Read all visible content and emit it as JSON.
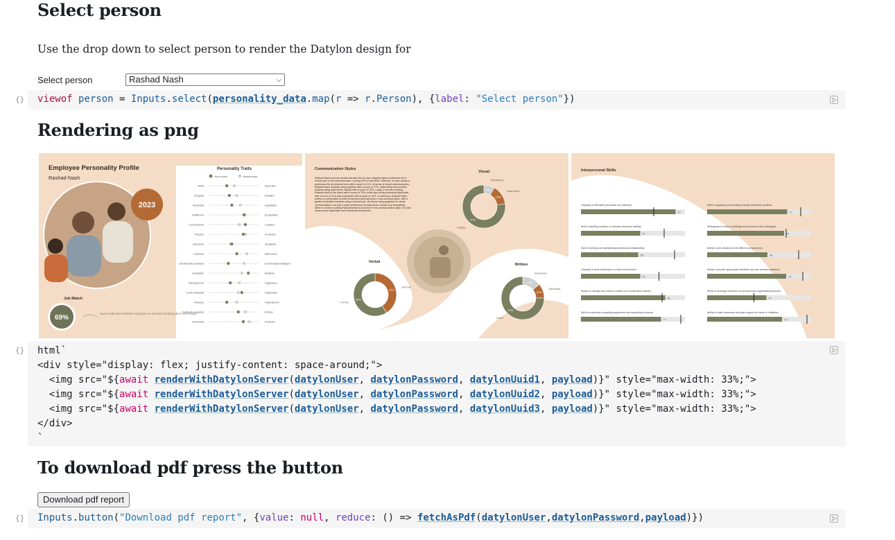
{
  "sections": {
    "select_title": "Select person",
    "select_desc": "Use the drop down to select person to render the Datylon design for",
    "png_title": "Rendering as png",
    "pdf_title": "To download pdf press the button"
  },
  "select": {
    "label": "Select person",
    "value": "Rashad Nash"
  },
  "cells": {
    "gutter_icon": "{}",
    "cell1": {
      "viewof": "viewof",
      "person": "person",
      "eq": " = ",
      "inputs": "Inputs",
      "dot1": ".",
      "select": "select",
      "open": "(",
      "pdata": "personality_data",
      "dot2": ".",
      "map": "map",
      "open2": "(",
      "r": "r",
      "arrow": " => ",
      "r2": "r",
      "dot3": ".",
      "Person": "Person",
      "close": "), {",
      "labelkey": "label",
      "colon": ": ",
      "labelval": "\"Select person\"",
      "end": "})"
    },
    "cell2": {
      "l1": "html`",
      "l2": "<div style=\"display: flex; justify-content: space-around;\">",
      "img_pre": "  <img src=\"${",
      "await": "await",
      "render": "renderWithDatylonServer",
      "user": "datylonUser",
      "pass": "datylonPassword",
      "uuid1": "datylonUuid1",
      "uuid2": "datylonUuid2",
      "uuid3": "datylonUuid3",
      "payload": "payload",
      "img_post": ")}\" style=\"max-width: 33%;\">",
      "l6": "</div>",
      "l7": "`"
    },
    "cell3": {
      "inputs": "Inputs",
      "button": "button",
      "str": "\"Download pdf report\"",
      "mid": ", {",
      "value": "value",
      "null": "null",
      "reduce": "reduce",
      "fn": "() => ",
      "fetch": "fetchAsPdf",
      "user": "datylonUser",
      "pass": "datylonPassword",
      "payload": "payload",
      "end": ")})"
    }
  },
  "button": {
    "label": "Download pdf report"
  },
  "panel1": {
    "title": "Employee Personality Profile",
    "name": "Rashad Nash",
    "year": "2023",
    "traits_title": "Personality Traits",
    "legend_you": "Your score",
    "legend_bench": "Benchmark",
    "job_match_label": "Job Match",
    "job_match_value": "69%",
    "job_note": "Score indicates whether employee is overall matching their current job",
    "traits": [
      {
        "left": "Timid",
        "right": "Assertive",
        "v": 0.35,
        "b": 0.5
      },
      {
        "left": "Irregular",
        "right": "Realism",
        "v": 0.4,
        "b": 0.55
      },
      {
        "left": "Resistant",
        "right": "Adaptable",
        "v": 0.45,
        "b": 0.62
      },
      {
        "left": "Indifferent",
        "right": "Empathetic",
        "v": 0.7,
        "b": 0.68
      },
      {
        "left": "Conventional",
        "right": "Creative",
        "v": 0.72,
        "b": 0.6
      },
      {
        "left": "Passive",
        "right": "Proactive",
        "v": 0.68,
        "b": 0.72
      },
      {
        "left": "Impulsive",
        "right": "Analytical",
        "v": 0.45,
        "b": 0.42
      },
      {
        "left": "Careless",
        "right": "Meticulous",
        "v": 0.55,
        "b": 0.75
      },
      {
        "left": "Emotionally unaware",
        "right": "Emotionally intelligent",
        "v": 0.38,
        "b": 0.7
      },
      {
        "left": "Unreliable",
        "right": "Reliable",
        "v": 0.78,
        "b": 0.65
      },
      {
        "left": "Disorganized",
        "right": "Organized",
        "v": 0.42,
        "b": 0.6
      },
      {
        "left": "Confrontational",
        "right": "Diplomatic",
        "v": 0.65,
        "b": 0.58
      },
      {
        "left": "Follower",
        "right": "Inspirational",
        "v": 0.35,
        "b": 0.55
      },
      {
        "left": "Culturally unaware",
        "right": "Ethical",
        "v": 0.58,
        "b": 0.72
      },
      {
        "left": "Dishonest",
        "right": "Inclusive",
        "v": 0.68,
        "b": 0.8
      }
    ]
  },
  "panel2": {
    "title": "Communication Styles",
    "text": "Rashad Nash's survey results indicate that he has a slightly higher preference for a formal tone in his communication, scoring 59% in that area. However, he also shows a preference for an informal tone with a score of 41%. In terms of visual communication, Rashad leans towards using graphics with a score of 77%, while being less inclined towards using data-driven visuals with a score of 15%. Lastly, in terms of writing, Rashad tends to be direct with a score of 75%, while also being somewhat diplomatic with a score of 11% and expressive with a score of 14%. In summary, Rashad Nash prefers a combination of both formal and informal tones in his communication, with a greater inclination towards using a formal tone. He favors using graphics for visual communication, but has a lower preference for data-driven visuals and storytelling. When it comes to writing Rashad tends to be direct in his communication style, but also shows some diplomatic and expressive tendencies.",
    "visual": {
      "title": "Visual",
      "labels": [
        "Storytelling",
        "Data-driven",
        "Graphic"
      ],
      "values": [
        8,
        15,
        77
      ]
    },
    "verbal": {
      "title": "Verbal",
      "labels": [
        "Informal",
        "Formal"
      ],
      "values": [
        41,
        59
      ]
    },
    "written": {
      "title": "Written",
      "labels": [
        "Expressive",
        "Diplomatic",
        "Direct"
      ],
      "values": [
        14,
        11,
        75
      ]
    }
  },
  "panel3": {
    "title": "Interpersonal Skills",
    "skills_left": [
      {
        "label": "Capacity to effectively persuade and influence",
        "v": 91,
        "b": 70
      },
      {
        "label": "Skill in handling sensitive or delicate situations tactfully",
        "v": 57,
        "b": 80
      },
      {
        "label": "Skill in building and maintaining professional relationships",
        "v": 55,
        "b": 90
      },
      {
        "label": "Capacity to work effectively in a team environment",
        "v": 57,
        "b": 75
      },
      {
        "label": "Ability to manage and resolve conflicts in a constructive manner",
        "v": 81,
        "b": 78
      },
      {
        "label": "Skill in presenting compelling arguments and supporting evidence",
        "v": 77,
        "b": 96
      }
    ],
    "skills_right": [
      {
        "label": "Skill in negotiating and finding mutually beneficial solutions",
        "v": 77,
        "b": 90
      },
      {
        "label": "Willingness to share knowledge and resources with colleagues",
        "v": 74,
        "b": 76
      },
      {
        "label": "Ability to see situations from different perspectives",
        "v": 58,
        "b": 88
      },
      {
        "label": "Ability to provide appropriate feedback and ask relevant questions",
        "v": 76,
        "b": 92
      },
      {
        "label": "Ability to leverage networks for personal and organizational growth",
        "v": 57,
        "b": 45
      },
      {
        "label": "Ability to build consensus and gain support for ideas or initiatives",
        "v": 72,
        "b": 96
      }
    ]
  },
  "colors": {
    "olive": "#7a7f5f",
    "bronze": "#b46a35",
    "peach": "#f4dcc6",
    "grey": "#cfcfcf"
  }
}
